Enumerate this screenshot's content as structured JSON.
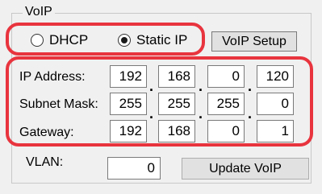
{
  "group": {
    "title": "VoIP"
  },
  "mode": {
    "dhcp_label": "DHCP",
    "static_label": "Static IP",
    "selected": "static"
  },
  "buttons": {
    "setup_label": "VoIP Setup",
    "update_label": "Update VoIP"
  },
  "fields": [
    {
      "label": "IP Address:",
      "octets": [
        "192",
        "168",
        "0",
        "120"
      ]
    },
    {
      "label": "Subnet Mask:",
      "octets": [
        "255",
        "255",
        "255",
        "0"
      ]
    },
    {
      "label": "Gateway:",
      "octets": [
        "192",
        "168",
        "0",
        "1"
      ]
    }
  ],
  "vlan": {
    "label": "VLAN:",
    "value": "0"
  },
  "colors": {
    "highlight": "#e8343e"
  }
}
